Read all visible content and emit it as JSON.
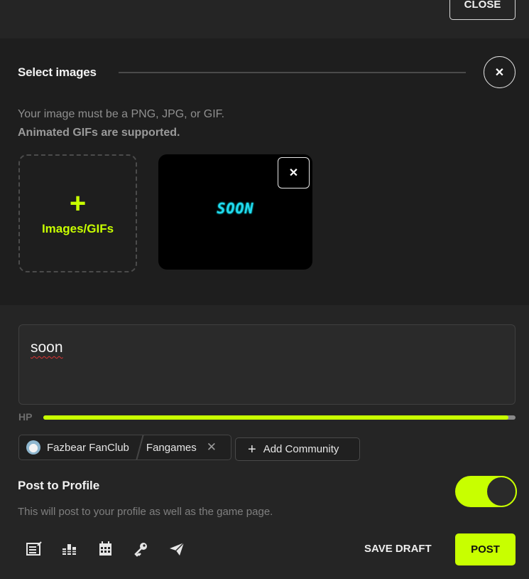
{
  "header": {
    "close_label": "CLOSE"
  },
  "images": {
    "title": "Select images",
    "help_line1": "Your image must be a PNG, JPG, or GIF.",
    "help_line2": "Animated GIFs are supported.",
    "add_label": "Images/GIFs",
    "thumbnail_text": "SOON"
  },
  "post": {
    "body_text": "soon",
    "hp_label": "HP",
    "hp_fraction": 0.985
  },
  "community": {
    "name": "Fazbear FanClub",
    "category": "Fangames",
    "add_label": "Add Community"
  },
  "profile": {
    "title": "Post to Profile",
    "help": "This will post to your profile as well as the game page.",
    "toggle_on": true
  },
  "footer": {
    "tool_icons": [
      "article-icon",
      "chart-icon",
      "calendar-icon",
      "key-icon",
      "send-icon"
    ],
    "save_draft_label": "SAVE DRAFT",
    "post_label": "POST"
  },
  "colors": {
    "accent": "#c8ff00",
    "panel": "#1e1e1e",
    "panel_alt": "#252525"
  }
}
